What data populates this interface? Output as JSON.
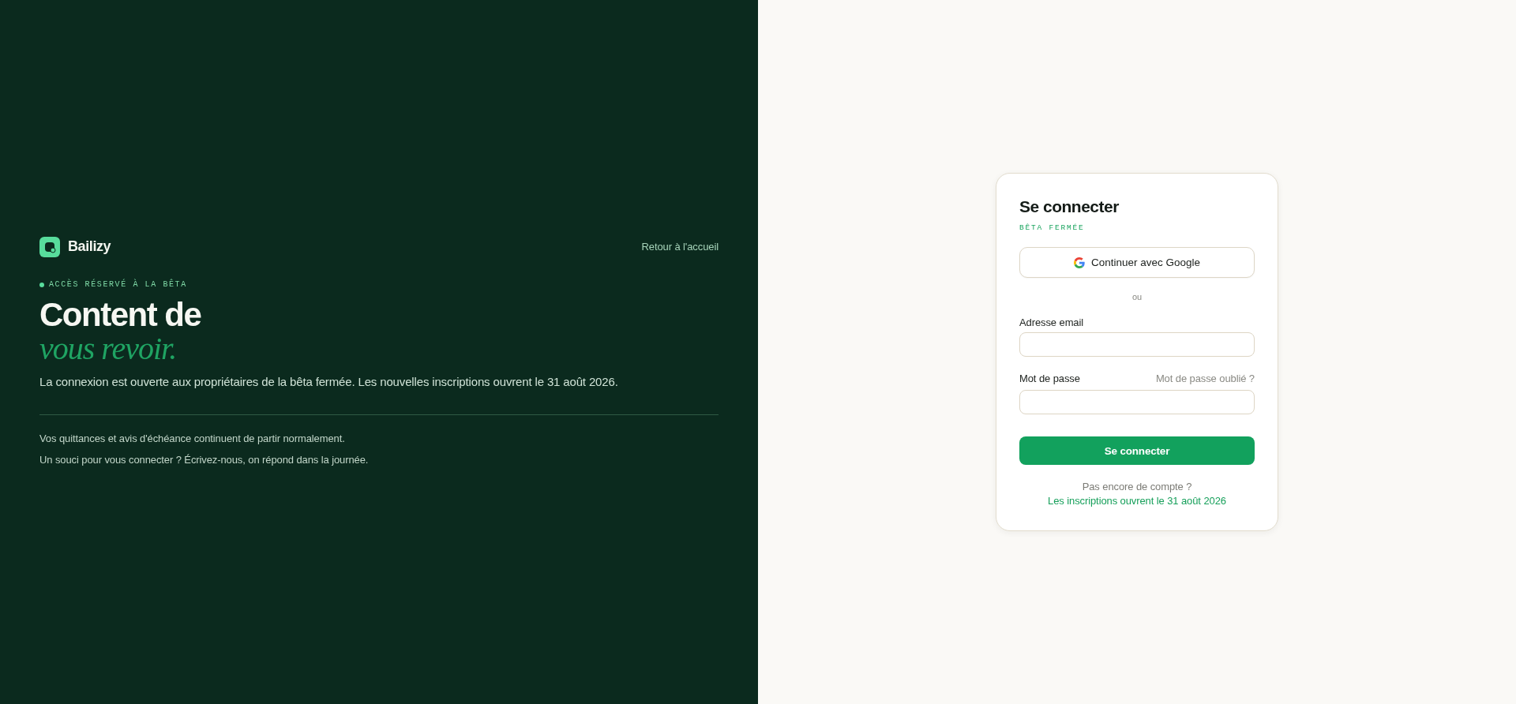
{
  "brand": {
    "name": "Bailizy"
  },
  "back_link": "Retour à l'accueil",
  "hero": {
    "eyebrow": "ACCÈS RÉSERVÉ À LA BÊTA",
    "title": "Content de",
    "title_accent": "vous revoir.",
    "lead": "La connexion est ouverte aux propriétaires de la bêta fermée. Les nouvelles inscriptions ouvrent le 31 août 2026."
  },
  "notes": [
    "Vos quittances et avis d'échéance continuent de partir normalement.",
    "Un souci pour vous connecter ? Écrivez-nous, on répond dans la journée."
  ],
  "login_card": {
    "title": "Se connecter",
    "badge": "BÊTA FERMÉE",
    "google_button": "Continuer avec Google",
    "separator": "ou",
    "fields": [
      {
        "label": "Adresse email"
      },
      {
        "label": "Mot de passe",
        "aside_link": "Mot de passe oublié ?"
      }
    ],
    "submit": "Se connecter",
    "signup_note": {
      "text": "Pas encore de compte ?",
      "link": "Les inscriptions ouvrent le 31 août 2026"
    }
  }
}
